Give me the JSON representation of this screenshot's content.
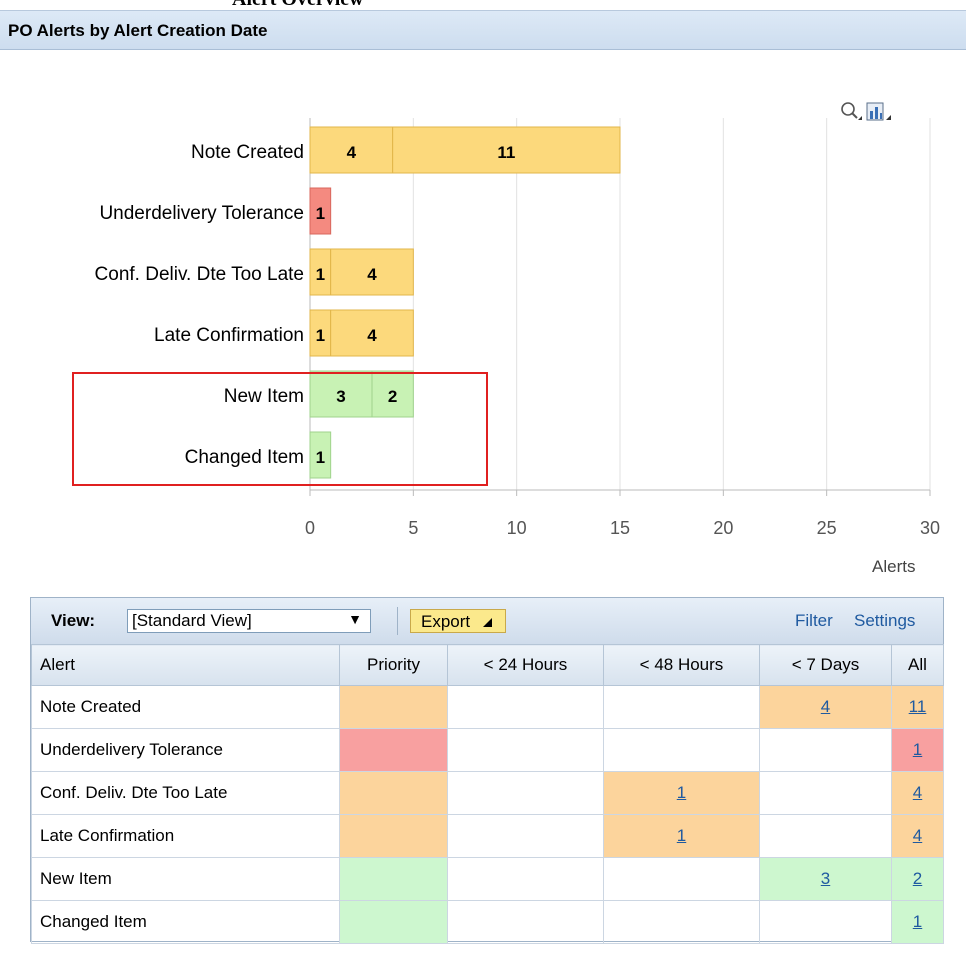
{
  "window": {
    "clipped_title": "Alert Overview",
    "panel_title": "PO Alerts by Alert Creation Date"
  },
  "chart_tools": {
    "zoom_icon": "magnifier-icon",
    "chart_type_icon": "bar-chart-icon"
  },
  "chart_data": {
    "type": "bar",
    "orientation": "horizontal",
    "stacked": true,
    "categories": [
      "Note Created",
      "Underdelivery Tolerance",
      "Conf. Deliv. Dte Too Late",
      "Late Confirmation",
      "New Item",
      "Changed Item"
    ],
    "segments": [
      [
        {
          "value": 4,
          "color": "#fcd97c"
        },
        {
          "value": 11,
          "color": "#fcd97c"
        }
      ],
      [
        {
          "value": 1,
          "color": "#f48a80"
        }
      ],
      [
        {
          "value": 1,
          "color": "#fcd97c"
        },
        {
          "value": 4,
          "color": "#fcd97c"
        }
      ],
      [
        {
          "value": 1,
          "color": "#fcd97c"
        },
        {
          "value": 4,
          "color": "#fcd97c"
        }
      ],
      [
        {
          "value": 3,
          "color": "#c8f2b4"
        },
        {
          "value": 2,
          "color": "#c8f2b4"
        }
      ],
      [
        {
          "value": 1,
          "color": "#c8f2b4"
        }
      ]
    ],
    "xlim": [
      0,
      30
    ],
    "xticks": [
      0,
      5,
      10,
      15,
      20,
      25,
      30
    ],
    "xlabel": "Alerts",
    "grid": true
  },
  "table": {
    "view_label": "View:",
    "view_value": "[Standard View]",
    "export_label": "Export",
    "filter_label": "Filter",
    "settings_label": "Settings",
    "headers": [
      "Alert",
      "Priority",
      "< 24 Hours",
      "< 48 Hours",
      "< 7 Days",
      "All"
    ],
    "rows": [
      {
        "alert": "Note Created",
        "priority_color": "#fcd49c",
        "h24": "",
        "h48": "",
        "d7": "4",
        "all": "11"
      },
      {
        "alert": "Underdelivery Tolerance",
        "priority_color": "#f8a0a0",
        "h24": "",
        "h48": "",
        "d7": "",
        "all": "1"
      },
      {
        "alert": "Conf. Deliv. Dte Too Late",
        "priority_color": "#fcd49c",
        "h24": "",
        "h48": "1",
        "d7": "",
        "all": "4"
      },
      {
        "alert": "Late Confirmation",
        "priority_color": "#fcd49c",
        "h24": "",
        "h48": "1",
        "d7": "",
        "all": "4"
      },
      {
        "alert": "New Item",
        "priority_color": "#cdf7cf",
        "h24": "",
        "h48": "",
        "d7": "3",
        "all": "2"
      },
      {
        "alert": "Changed Item",
        "priority_color": "#cdf7cf",
        "h24": "",
        "h48": "",
        "d7": "",
        "all": "1"
      }
    ]
  }
}
